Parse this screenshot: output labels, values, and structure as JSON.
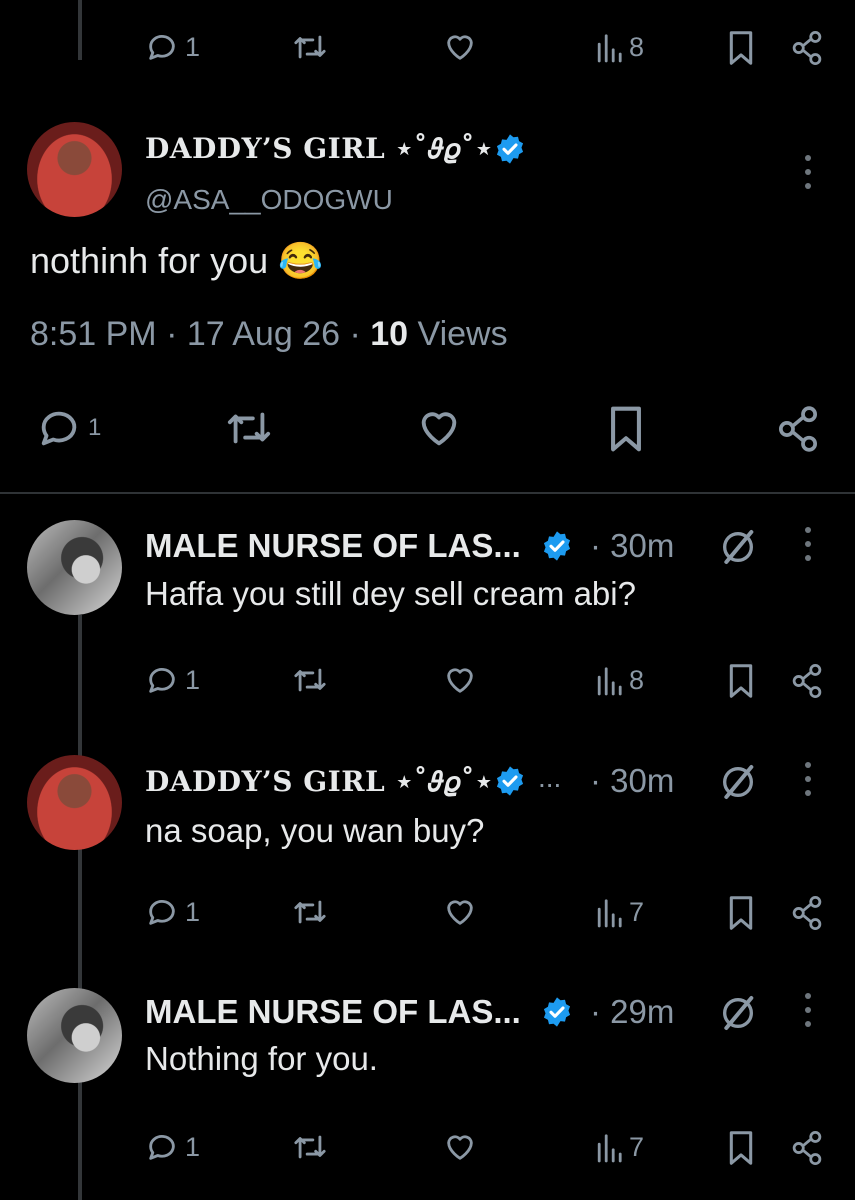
{
  "top_actions": {
    "replies": "1",
    "views": "8"
  },
  "main_tweet": {
    "display_name": "DADDY’S GIRL ⋆˚𝜗𝜚˚⋆",
    "handle": "@ASA__ODOGWU",
    "text": "nothinh for you 😂",
    "time": "8:51 PM",
    "date": "17 Aug 26",
    "views_count": "10",
    "views_label": "Views",
    "sep": "·",
    "actions": {
      "replies": "1"
    }
  },
  "replies": [
    {
      "display_name": "MALE NURSE OF LAS...",
      "age": "· 30m",
      "text": "Haffa you still dey sell cream abi?",
      "replies": "1",
      "views": "8"
    },
    {
      "display_name": "DADDY’S GIRL ⋆˚𝜗𝜚˚⋆",
      "ellipsis": "...",
      "age": "· 30m",
      "text": "na soap, you wan buy?",
      "replies": "1",
      "views": "7"
    },
    {
      "display_name": "MALE NURSE OF LAS...",
      "age": "· 29m",
      "text": "Nothing for you.",
      "replies": "1",
      "views": "7"
    }
  ],
  "colors": {
    "background": "#000000",
    "text": "#e7e9ea",
    "muted": "#8b98a5",
    "verified": "#1d9bf0",
    "divider": "#2f3336"
  }
}
